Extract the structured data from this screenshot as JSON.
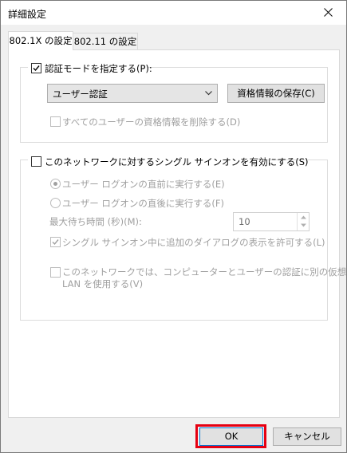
{
  "window": {
    "title": "詳細設定"
  },
  "tabs": [
    {
      "label": "802.1X の設定"
    },
    {
      "label": "802.11 の設定"
    }
  ],
  "auth_group": {
    "checkbox_label": "認証モードを指定する(P):",
    "checked": true,
    "mode_select": {
      "value": "ユーザー認証"
    },
    "save_credentials_button": "資格情報の保存(C)",
    "delete_credentials_label": "すべてのユーザーの資格情報を削除する(D)",
    "delete_credentials_checked": false
  },
  "sso_group": {
    "checkbox_label": "このネットワークに対するシングル サインオンを有効にする(S)",
    "checked": false,
    "radio_before_label": "ユーザー ログオンの直前に実行する(E)",
    "radio_before_selected": true,
    "radio_after_label": "ユーザー ログオンの直後に実行する(F)",
    "radio_after_selected": false,
    "max_wait_label": "最大待ち時間 (秒)(M):",
    "max_wait_value": "10",
    "allow_dialogs_label": "シングル サインオン中に追加のダイアログの表示を許可する(L)",
    "allow_dialogs_checked": true,
    "separate_vlan_label_line1": "このネットワークでは、コンピューターとユーザーの認証に別の仮想",
    "separate_vlan_label_line2": "LAN を使用する(V)",
    "separate_vlan_checked": false
  },
  "footer": {
    "ok_label": "OK",
    "cancel_label": "キャンセル",
    "highlight_color": "#e60012"
  }
}
